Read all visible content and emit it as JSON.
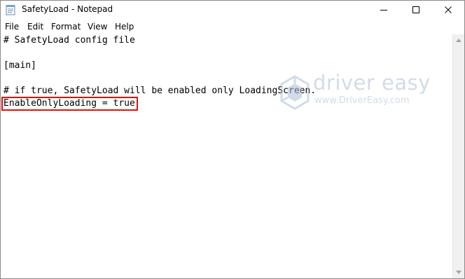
{
  "window": {
    "title": "SafetyLoad - Notepad",
    "icon": "notepad-icon",
    "controls": [
      "minimize-icon",
      "maximize-icon",
      "close-icon"
    ]
  },
  "menu": {
    "file": "File",
    "edit": "Edit",
    "format": "Format",
    "view": "View",
    "help": "Help"
  },
  "editor": {
    "lines": [
      "# SafetyLoad config file",
      "",
      "[main]",
      "",
      "# if true, SafetyLoad will be enabled only LoadingScreen.",
      "EnableOnlyLoading = true"
    ],
    "highlighted_line_color": "#e01010"
  },
  "watermark": {
    "brand": "driver easy",
    "url": "www.DriverEasy.com"
  }
}
